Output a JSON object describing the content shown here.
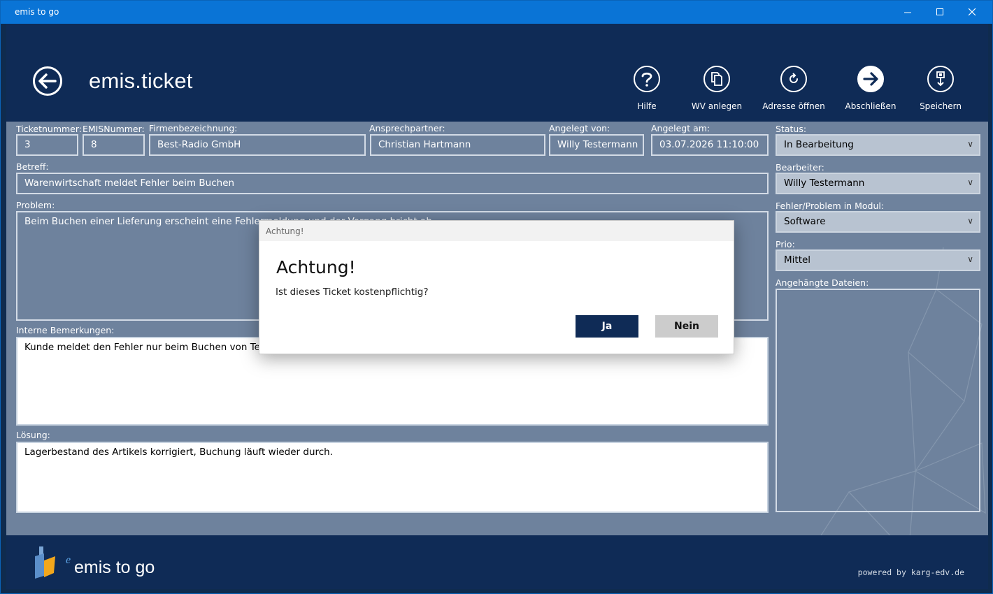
{
  "window": {
    "title": "emis to go"
  },
  "header": {
    "app_title": "emis.ticket",
    "tools": [
      {
        "label": "Hilfe",
        "icon": "help-icon"
      },
      {
        "label": "WV anlegen",
        "icon": "copy-icon"
      },
      {
        "label": "Adresse öffnen",
        "icon": "refresh-icon"
      },
      {
        "label": "Abschließen",
        "icon": "arrow-right-icon"
      },
      {
        "label": "Speichern",
        "icon": "save-icon"
      }
    ]
  },
  "form": {
    "ticketnummer": {
      "label": "Ticketnummer:",
      "value": "3"
    },
    "emisnummer": {
      "label": "EMISNummer:",
      "value": "8"
    },
    "firma": {
      "label": "Firmenbezeichnung:",
      "value": "Best-Radio GmbH"
    },
    "ansprechpartner": {
      "label": "Ansprechpartner:",
      "value": "Christian Hartmann"
    },
    "angelegt_von": {
      "label": "Angelegt von:",
      "value": "Willy Testermann"
    },
    "angelegt_am": {
      "label": "Angelegt am:",
      "value": "03.07.2026 11:10:00"
    },
    "betreff": {
      "label": "Betreff:",
      "value": "Warenwirtschaft meldet Fehler beim Buchen"
    },
    "problem": {
      "label": "Problem:",
      "value": "Beim Buchen einer Lieferung erscheint eine Fehlermeldung und der Vorgang bricht ab."
    },
    "interne": {
      "label": "Interne Bemerkungen:",
      "value": "Kunde meldet den Fehler nur beim Buchen von Teillieferungen."
    },
    "loesung": {
      "label": "Lösung:",
      "value": "Lagerbestand des Artikels korrigiert, Buchung läuft wieder durch."
    }
  },
  "side": {
    "status": {
      "label": "Status:",
      "value": "In Bearbeitung"
    },
    "bearbeiter": {
      "label": "Bearbeiter:",
      "value": "Willy Testermann"
    },
    "modul": {
      "label": "Fehler/Problem in Modul:",
      "value": "Software"
    },
    "prio": {
      "label": "Prio:",
      "value": "Mittel"
    },
    "dateien": {
      "label": "Angehängte Dateien:"
    }
  },
  "footer": {
    "brand": "emis to go",
    "powered": "powered by karg-edv.de"
  },
  "dialog": {
    "title": "Achtung!",
    "heading": "Achtung!",
    "message": "Ist dieses Ticket kostenpflichtig?",
    "yes": "Ja",
    "no": "Nein"
  }
}
